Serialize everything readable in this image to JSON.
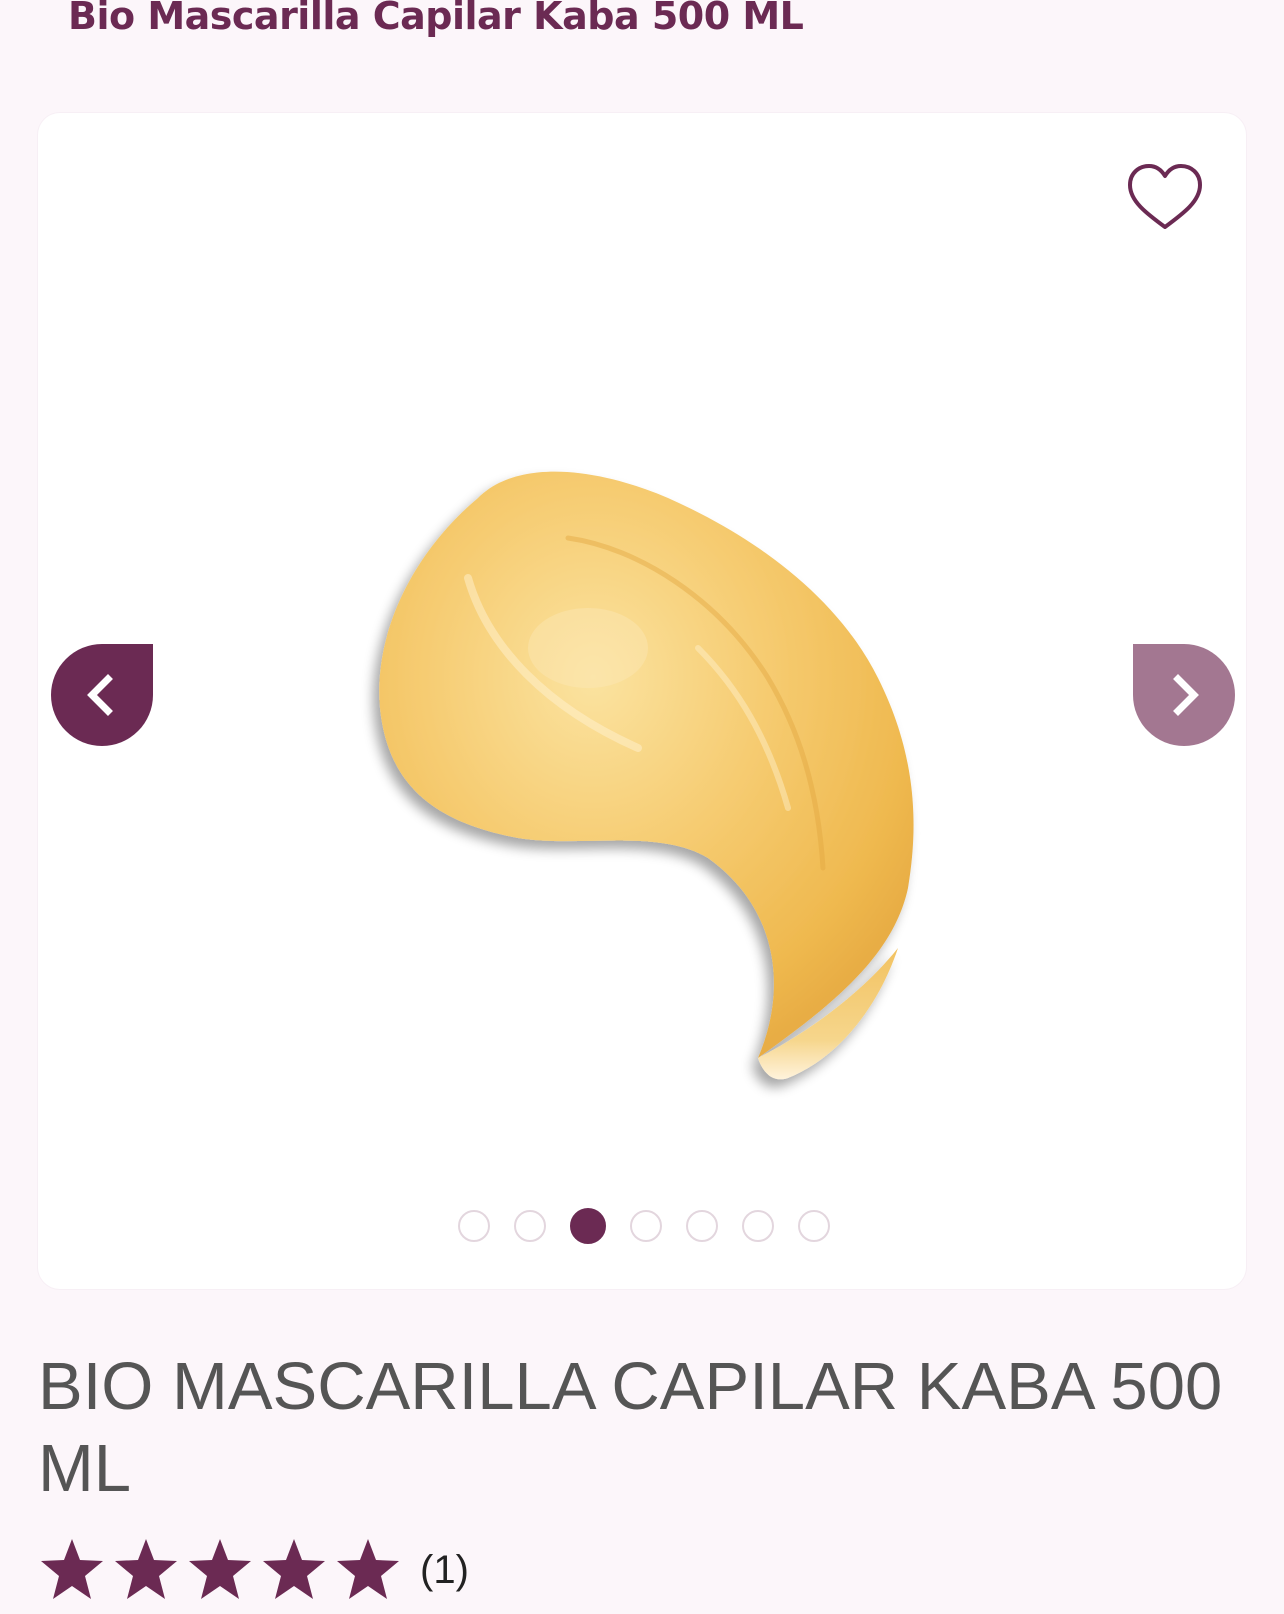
{
  "header": {
    "product_name": "Bio Mascarilla Capilar Kaba 500 ML"
  },
  "gallery": {
    "wishlist_icon": "heart-outline-icon",
    "prev_icon": "chevron-left-icon",
    "next_icon": "chevron-right-icon",
    "image_count": 7,
    "active_index": 3
  },
  "product": {
    "title": "BIO MASCARILLA CAPILAR KABA 500 ML",
    "rating": 5,
    "rating_max": 5,
    "review_count": "(1)"
  },
  "colors": {
    "brand": "#6b2a53",
    "brand_light": "#a37791",
    "background": "#fcf6fa",
    "title_text": "#555555"
  }
}
